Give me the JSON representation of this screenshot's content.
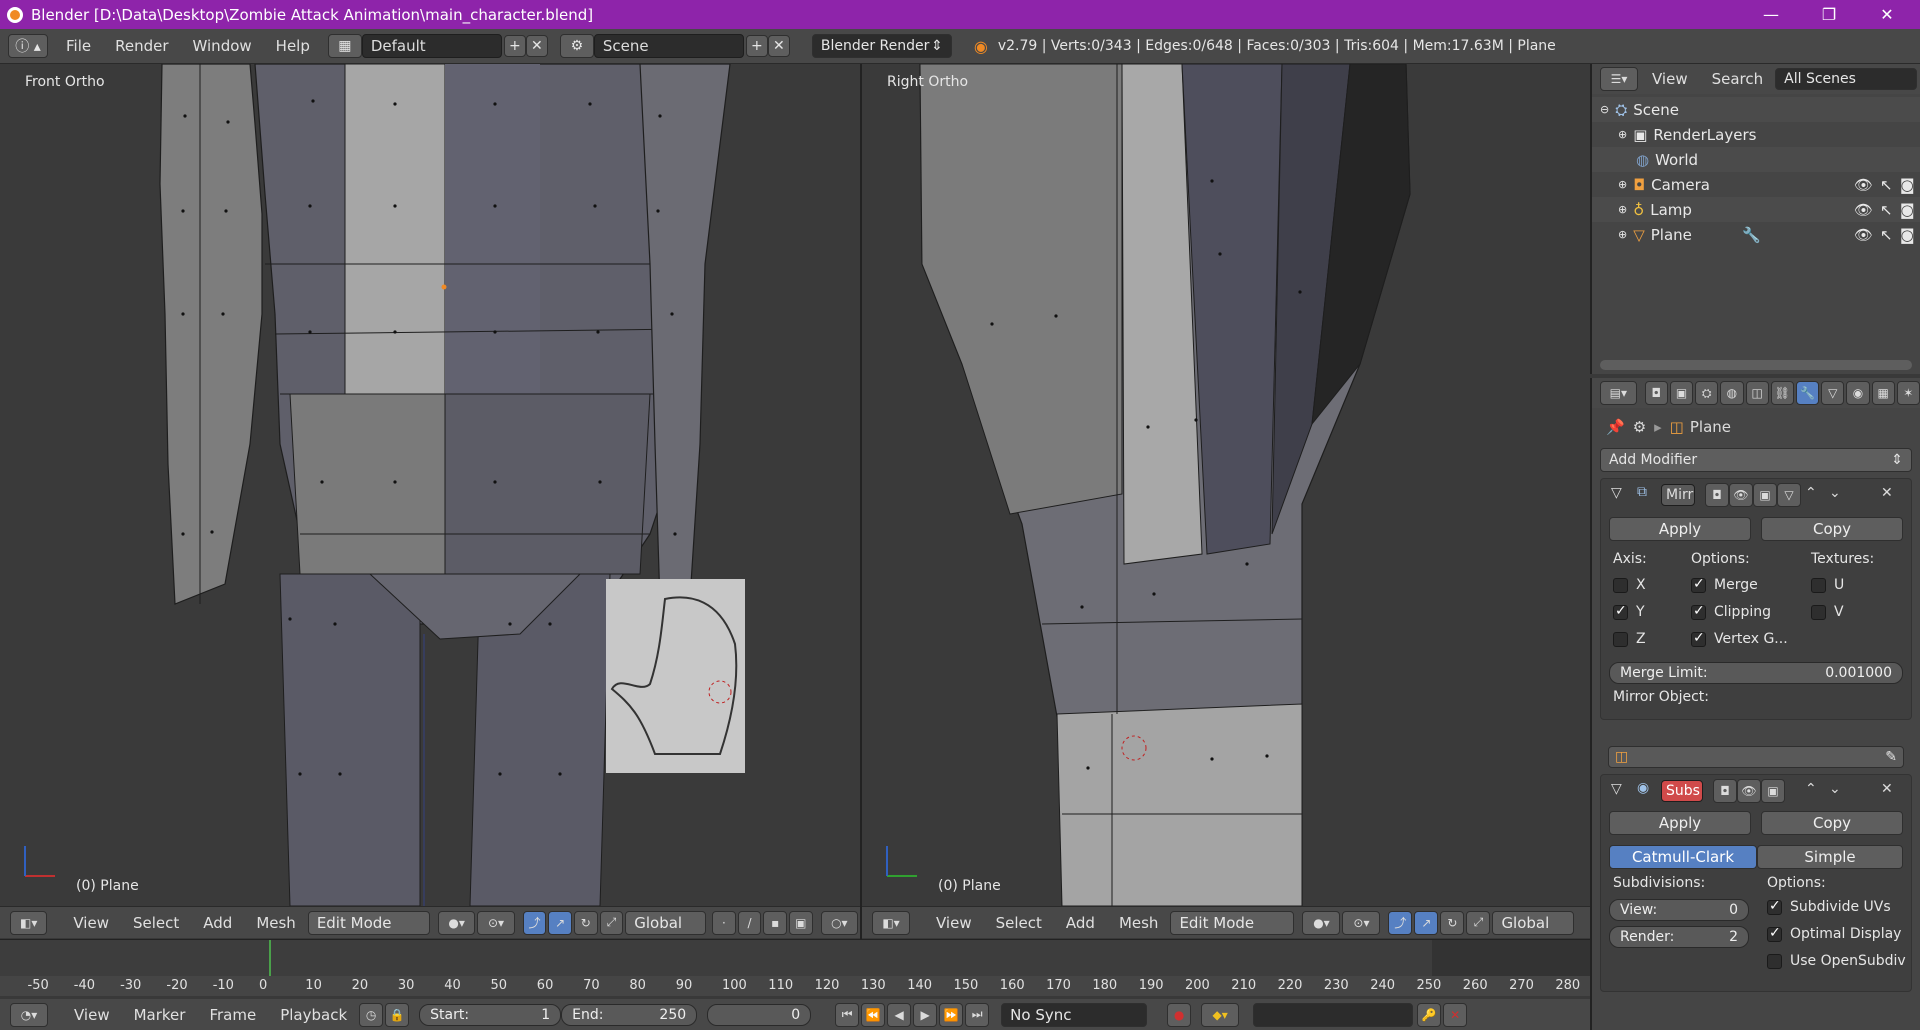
{
  "window": {
    "title": "Blender [D:\\Data\\Desktop\\Zombie Attack Animation\\main_character.blend]",
    "minimize": "—",
    "maximize": "❐",
    "close": "✕"
  },
  "menu": {
    "file": "File",
    "render": "Render",
    "window": "Window",
    "help": "Help"
  },
  "layout": {
    "screen": "Default",
    "scene": "Scene",
    "engine": "Blender Render"
  },
  "stats": "v2.79 | Verts:0/343 | Edges:0/648 | Faces:0/303 | Tris:604 | Mem:17.63M | Plane",
  "viewport_left": {
    "label": "Front Ortho",
    "object": "(0) Plane"
  },
  "viewport_right": {
    "label": "Right Ortho",
    "object": "(0) Plane"
  },
  "view_header": {
    "view": "View",
    "select": "Select",
    "add": "Add",
    "mesh": "Mesh",
    "mode": "Edit Mode",
    "orientation": "Global"
  },
  "timeline": {
    "ticks": [
      "-50",
      "-40",
      "-30",
      "-20",
      "-10",
      "0",
      "10",
      "20",
      "30",
      "40",
      "50",
      "60",
      "70",
      "80",
      "90",
      "100",
      "110",
      "120",
      "130",
      "140",
      "150",
      "160",
      "170",
      "180",
      "190",
      "200",
      "210",
      "220",
      "230",
      "240",
      "250",
      "260",
      "270",
      "280"
    ],
    "view": "View",
    "marker": "Marker",
    "frame": "Frame",
    "playback": "Playback",
    "start_label": "Start:",
    "start": "1",
    "end_label": "End:",
    "end": "250",
    "current": "0",
    "sync": "No Sync"
  },
  "outliner": {
    "view": "View",
    "search": "Search",
    "filter": "All Scenes",
    "items": [
      "Scene",
      "RenderLayers",
      "World",
      "Camera",
      "Lamp",
      "Plane"
    ]
  },
  "properties": {
    "object": "Plane",
    "add_modifier": "Add Modifier",
    "mirror": {
      "name": "Mirr",
      "apply": "Apply",
      "copy": "Copy",
      "axis": "Axis:",
      "options": "Options:",
      "textures": "Textures:",
      "x": "X",
      "y": "Y",
      "z": "Z",
      "merge": "Merge",
      "clipping": "Clipping",
      "vertex": "Vertex G...",
      "u": "U",
      "v": "V",
      "merge_limit_label": "Merge Limit:",
      "merge_limit": "0.001000",
      "mirror_object": "Mirror Object:"
    },
    "subsurf": {
      "name": "Subs",
      "apply": "Apply",
      "copy": "Copy",
      "catmull": "Catmull-Clark",
      "simple": "Simple",
      "subdivisions": "Subdivisions:",
      "options": "Options:",
      "view_label": "View:",
      "view": "0",
      "render_label": "Render:",
      "render": "2",
      "subdivide_uvs": "Subdivide UVs",
      "optimal": "Optimal Display",
      "opensubdiv": "Use OpenSubdiv"
    }
  }
}
